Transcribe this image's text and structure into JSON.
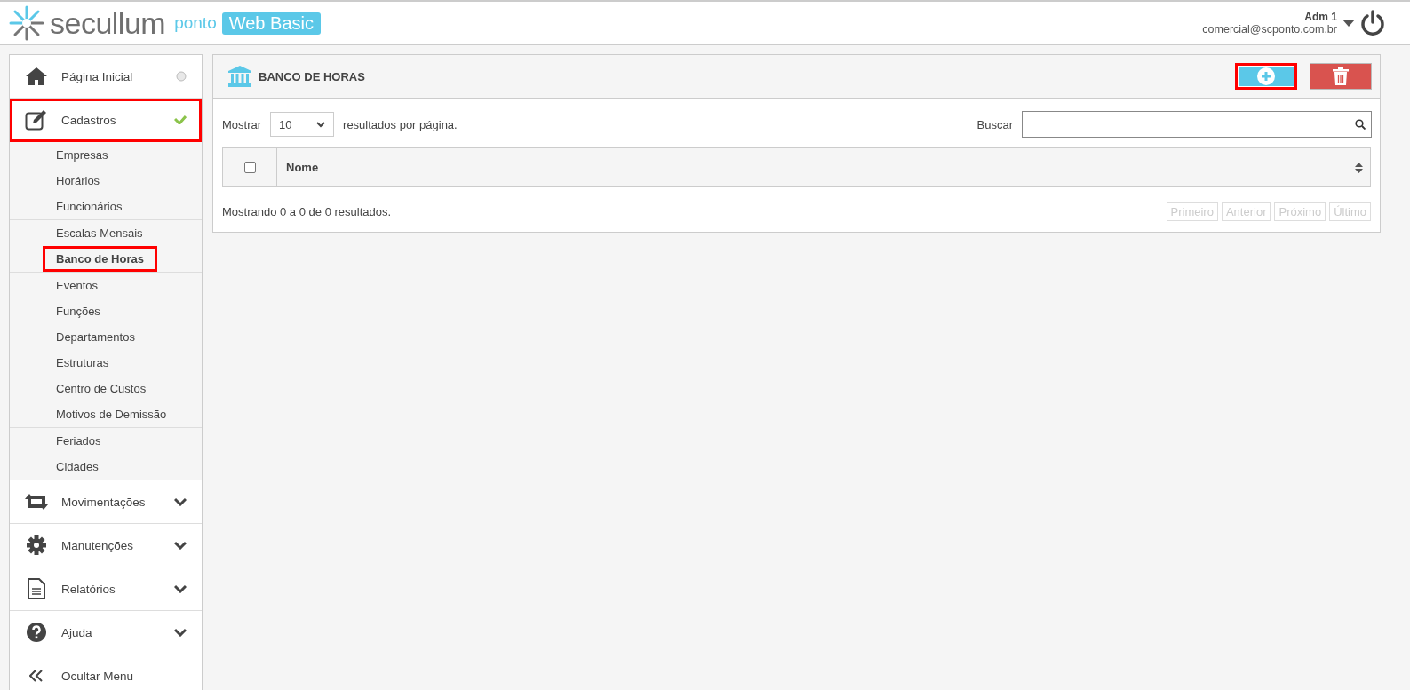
{
  "header": {
    "brand": "secullum",
    "product": "ponto",
    "edition": "Web Basic",
    "user": {
      "name": "Adm 1",
      "email": "comercial@scponto.com.br"
    }
  },
  "sidebar": {
    "items": [
      {
        "kind": "home",
        "label": "Página Inicial"
      },
      {
        "kind": "edit",
        "label": "Cadastros",
        "expanded": true,
        "highlighted": true,
        "groups": [
          {
            "items": [
              {
                "label": "Empresas",
                "selected": false,
                "highlighted": false
              },
              {
                "label": "Horários",
                "selected": false,
                "highlighted": false
              },
              {
                "label": "Funcionários",
                "selected": false,
                "highlighted": false
              }
            ]
          },
          {
            "items": [
              {
                "label": "Escalas Mensais",
                "selected": false,
                "highlighted": false
              },
              {
                "label": "Banco de Horas",
                "selected": true,
                "highlighted": true
              }
            ]
          },
          {
            "items": [
              {
                "label": "Eventos",
                "selected": false,
                "highlighted": false
              },
              {
                "label": "Funções",
                "selected": false,
                "highlighted": false
              },
              {
                "label": "Departamentos",
                "selected": false,
                "highlighted": false
              },
              {
                "label": "Estruturas",
                "selected": false,
                "highlighted": false
              },
              {
                "label": "Centro de Custos",
                "selected": false,
                "highlighted": false
              },
              {
                "label": "Motivos de Demissão",
                "selected": false,
                "highlighted": false
              }
            ]
          },
          {
            "items": [
              {
                "label": "Feriados",
                "selected": false,
                "highlighted": false
              },
              {
                "label": "Cidades",
                "selected": false,
                "highlighted": false
              }
            ]
          }
        ]
      },
      {
        "kind": "transfer",
        "label": "Movimentações",
        "expanded": false,
        "highlighted": false
      },
      {
        "kind": "gear",
        "label": "Manutenções",
        "expanded": false,
        "highlighted": false
      },
      {
        "kind": "document",
        "label": "Relatórios",
        "expanded": false,
        "highlighted": false
      },
      {
        "kind": "help",
        "label": "Ajuda",
        "expanded": false,
        "highlighted": false
      },
      {
        "kind": "collapse",
        "label": "Ocultar Menu"
      }
    ]
  },
  "panel": {
    "title": "BANCO DE HORAS",
    "add_highlighted": true,
    "page_size": {
      "label": "Mostrar",
      "value": "10",
      "suffix": "resultados por página."
    },
    "search": {
      "label": "Buscar"
    },
    "table": {
      "select_all_checked": false,
      "columns": [
        "Nome"
      ]
    },
    "info": "Mostrando 0 a 0 de 0 resultados.",
    "pagination": [
      {
        "label": "Primeiro",
        "disabled": true
      },
      {
        "label": "Anterior",
        "disabled": true
      },
      {
        "label": "Próximo",
        "disabled": true
      },
      {
        "label": "Último",
        "disabled": true
      }
    ]
  }
}
